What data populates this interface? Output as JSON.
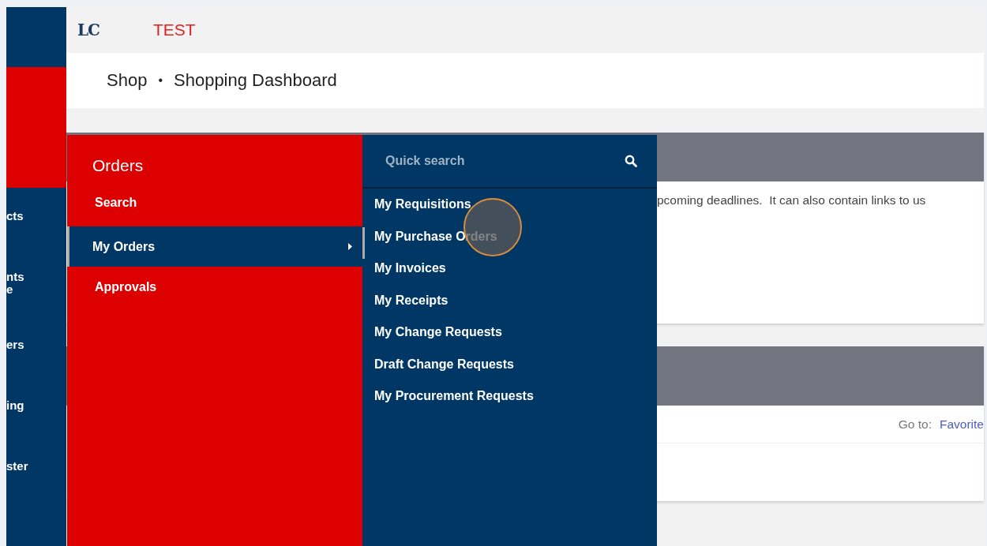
{
  "sidebar": {
    "items": [
      {
        "label": "cts"
      },
      {
        "label": "nts\ne"
      },
      {
        "label": "ers"
      },
      {
        "label": "ing"
      },
      {
        "label": "ster"
      }
    ]
  },
  "header": {
    "logo": "LC",
    "environment": "TEST"
  },
  "breadcrumb": {
    "items": [
      "Shop",
      "Shopping Dashboard"
    ],
    "separator": "•"
  },
  "cards": [
    {
      "text": "pcoming deadlines.  It can also contain links to us"
    },
    {
      "goto_label": "Go to:",
      "goto_link": "Favorite"
    }
  ],
  "menu": {
    "title": "Orders",
    "items": [
      {
        "label": "Search",
        "selected": false,
        "has_submenu": false
      },
      {
        "label": "My Orders",
        "selected": true,
        "has_submenu": true
      },
      {
        "label": "Approvals",
        "selected": false,
        "has_submenu": false
      }
    ],
    "submenu": {
      "search": {
        "placeholder": "Quick search"
      },
      "items": [
        {
          "label": "My Requisitions",
          "selected": false
        },
        {
          "label": "My Purchase Orders",
          "selected": true
        },
        {
          "label": "My Invoices",
          "selected": false
        },
        {
          "label": "My Receipts",
          "selected": false
        },
        {
          "label": "My Change Requests",
          "selected": false
        },
        {
          "label": "Draft Change Requests",
          "selected": false
        },
        {
          "label": "My Procurement Requests",
          "selected": false
        }
      ]
    }
  }
}
